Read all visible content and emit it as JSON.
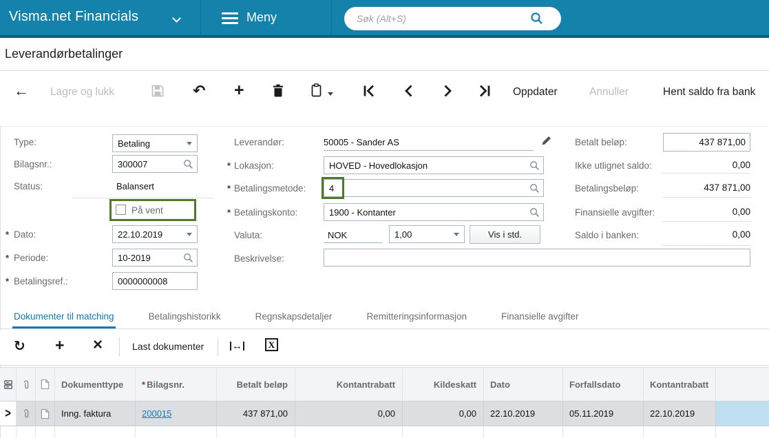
{
  "colors": {
    "topbar_blue": "#1482AA",
    "topbar_border": "#0a5d82",
    "accent_blue": "#1178B5",
    "annotation_green": "#517a28",
    "selected_row_gray": "#dcdee1",
    "highlight_cell_blue": "#bfe0f2",
    "disabled_gray": "#b9bdc1"
  },
  "icons": {
    "back": "←",
    "undo": "↶",
    "plus": "+",
    "refresh": "↻",
    "delete_x": "×",
    "fit_arrow": "↔",
    "excel_letter": "X",
    "row_chevron": ">"
  },
  "topbar": {
    "brand": "Visma.net Financials",
    "menu_label": "Meny",
    "search_placeholder": "Søk (Alt+S)"
  },
  "page": {
    "title": "Leverandørbetalinger"
  },
  "toolbar": {
    "save_close_label": "Lagre og lukk",
    "update_label": "Oppdater",
    "cancel_label": "Annuller",
    "bank_balance_label": "Hent saldo fra bank"
  },
  "form": {
    "left": {
      "type_label": "Type:",
      "type_value": "Betaling",
      "refnbr_label": "Bilagsnr.:",
      "refnbr_value": "300007",
      "status_label": "Status:",
      "status_value": "Balansert",
      "hold_label": "På vent",
      "date_label": "Dato:",
      "date_value": "22.10.2019",
      "period_label": "Periode:",
      "period_value": "10-2019",
      "payref_label": "Betalingsref.:",
      "payref_value": "0000000008"
    },
    "middle": {
      "vendor_label": "Leverandør:",
      "vendor_value": "50005 - Sander AS",
      "location_label": "Lokasjon:",
      "location_value": "HOVED - Hovedlokasjon",
      "method_label": "Betalingsmetode:",
      "method_value": "4",
      "account_label": "Betalingskonto:",
      "account_value": "1900 - Kontanter",
      "currency_label": "Valuta:",
      "currency_code": "NOK",
      "currency_rate": "1,00",
      "currency_button": "Vis i std.",
      "description_label": "Beskrivelse:",
      "description_value": ""
    },
    "right": {
      "paid_label": "Betalt beløp:",
      "paid_value": "437 871,00",
      "unapplied_label": "Ikke utlignet saldo:",
      "unapplied_value": "0,00",
      "payment_label": "Betalingsbeløp:",
      "payment_value": "437 871,00",
      "charges_label": "Finansielle avgifter:",
      "charges_value": "0,00",
      "bank_label": "Saldo i banken:",
      "bank_value": "0,00"
    }
  },
  "tabs": [
    {
      "label": "Dokumenter til matching"
    },
    {
      "label": "Betalingshistorikk"
    },
    {
      "label": "Regnskapsdetaljer"
    },
    {
      "label": "Remitteringsinformasjon"
    },
    {
      "label": "Finansielle avgifter"
    }
  ],
  "gridbar": {
    "load_documents_label": "Last dokumenter"
  },
  "table": {
    "columns": [
      {
        "label": ""
      },
      {
        "label": ""
      },
      {
        "label": ""
      },
      {
        "label": "Dokumenttype"
      },
      {
        "label": "Bilagsnr.",
        "required": "*"
      },
      {
        "label": "Betalt beløp"
      },
      {
        "label": "Kontantrabatt"
      },
      {
        "label": "Kildeskatt"
      },
      {
        "label": "Dato"
      },
      {
        "label": "Forfallsdato"
      },
      {
        "label": "Kontantrabatt"
      },
      {
        "label": ""
      }
    ],
    "rows": [
      {
        "doctype": "Inng. faktura",
        "refnbr": "200015",
        "paid_amount": "437 871,00",
        "cash_discount": "0,00",
        "withholding_tax": "0,00",
        "date": "22.10.2019",
        "due_date": "05.11.2019",
        "cash_discount_date": "22.10.2019"
      }
    ]
  }
}
